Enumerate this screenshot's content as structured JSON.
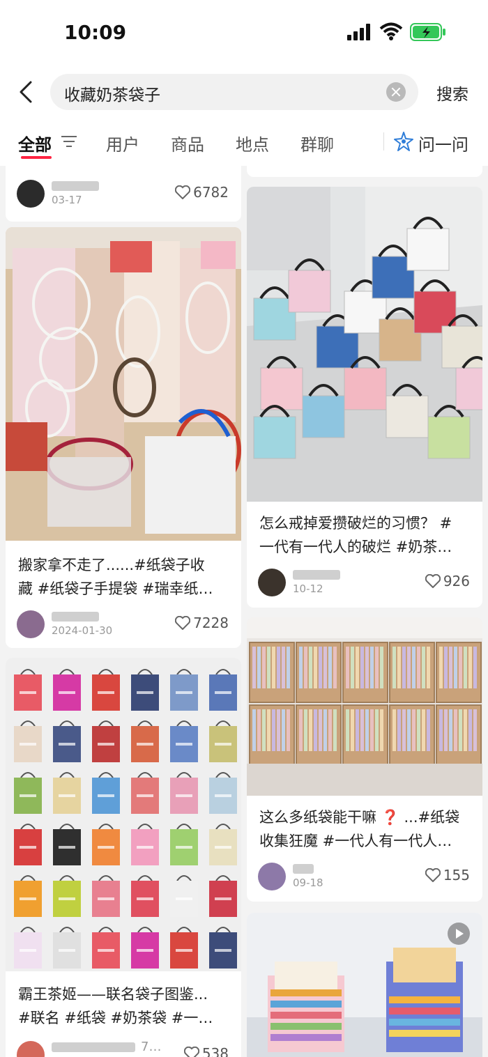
{
  "status": {
    "time": "10:09"
  },
  "search": {
    "query": "收藏奶茶袋子",
    "button": "搜索"
  },
  "tabs": [
    {
      "label": "全部"
    },
    {
      "label": "用户"
    },
    {
      "label": "商品"
    },
    {
      "label": "地点"
    },
    {
      "label": "群聊"
    }
  ],
  "ask": {
    "label": "问一问"
  },
  "colors": {
    "accent": "#ff2442",
    "battery": "#34c759"
  },
  "left_column": [
    {
      "date": "03-17",
      "likes": "6782"
    },
    {
      "title_line1": "搬家拿不走了......#纸袋子收",
      "title_line2": "藏 #纸袋子手提袋 #瑞幸纸…",
      "date": "2024-01-30",
      "likes": "7228"
    },
    {
      "title_line1": "霸王茶姬——联名袋子图鉴...",
      "title_line2": "#联名 #纸袋 #奶茶袋 #一…",
      "author_tail": "7…",
      "likes": "538"
    }
  ],
  "right_column": [
    {
      "title_line1": "怎么戒掉爱攒破烂的习惯？ #",
      "title_line2": "一代有一代人的破烂 #奶茶…",
      "date": "10-12",
      "likes": "926"
    },
    {
      "title_line1": "这么多纸袋能干嘛 ❓ ...#纸袋",
      "title_line2": "收集狂魔 #一代人有一代人…",
      "date": "09-18",
      "likes": "155"
    },
    {
      "image_caption": "纸袋展示"
    }
  ]
}
